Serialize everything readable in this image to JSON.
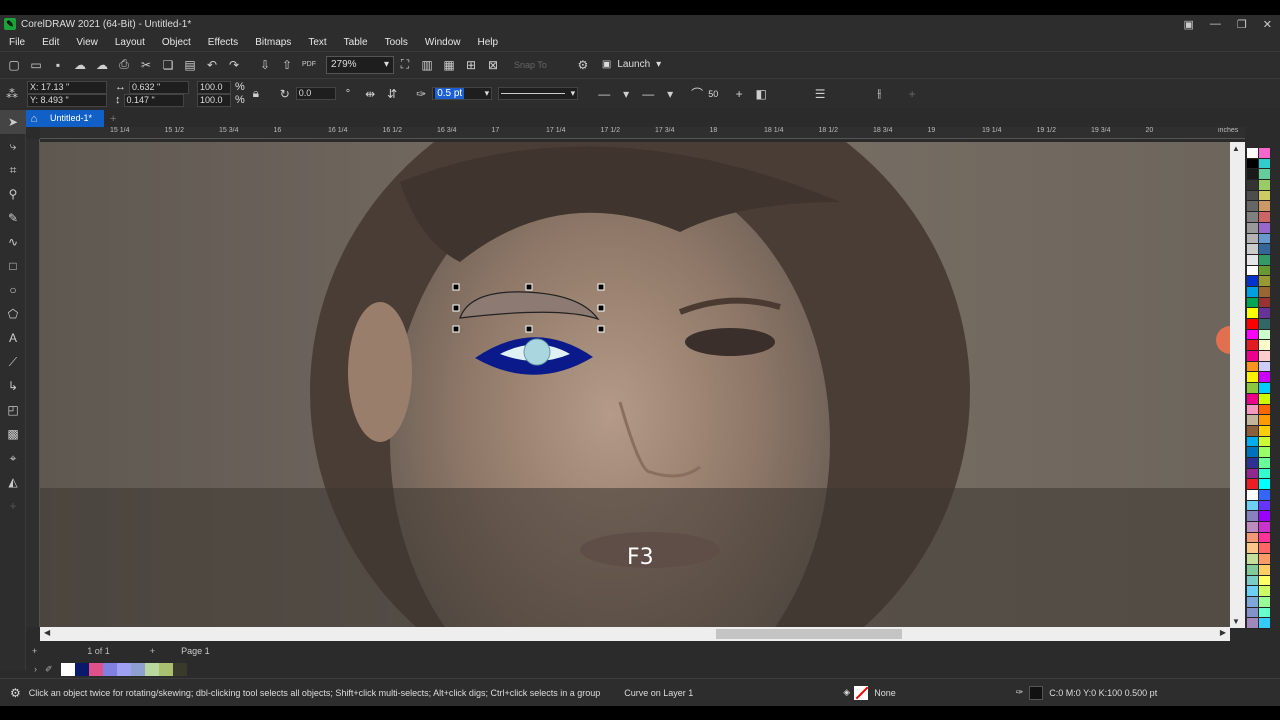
{
  "window": {
    "title": "CorelDRAW 2021 (64-Bit) - Untitled-1*"
  },
  "menu": [
    "File",
    "Edit",
    "View",
    "Layout",
    "Object",
    "Effects",
    "Bitmaps",
    "Text",
    "Table",
    "Tools",
    "Window",
    "Help"
  ],
  "toolbar": {
    "zoom": "279%",
    "pdf_label": "PDF",
    "snap_to": "Snap To",
    "launch_label": "Launch"
  },
  "property_bar": {
    "x": "X: 17.13 \"",
    "y": "Y: 8.493 \"",
    "w": "0.632 \"",
    "h": "0.147 \"",
    "scale_w": "100.0",
    "scale_h": "100.0",
    "percent": "%",
    "rotation": "0.0",
    "outline_width": "0.5 pt",
    "smoothing": "50"
  },
  "document": {
    "tab": "Untitled-1*",
    "page_count": "1 of 1",
    "page_tab": "Page 1"
  },
  "ruler": {
    "ticks": [
      "15 1/4",
      "15 1/2",
      "15 3/4",
      "16",
      "16 1/4",
      "16 1/2",
      "16 3/4",
      "17",
      "17 1/4",
      "17 1/2",
      "17 3/4",
      "18",
      "18 1/4",
      "18 1/2",
      "18 3/4",
      "19",
      "19 1/4",
      "19 1/2",
      "19 3/4",
      "20"
    ],
    "unit": "inches"
  },
  "canvas": {
    "overlay_text": "F3"
  },
  "status": {
    "hint": "Click an object twice for rotating/skewing; dbl-clicking tool selects all objects; Shift+click multi-selects; Alt+click digs; Ctrl+click selects in a group",
    "object_info": "Curve on Layer 1",
    "fill": "None",
    "outline_info": "C:0 M:0 Y:0 K:100  0.500 pt"
  },
  "colors": {
    "accent": "#1060c8",
    "eye_outline": "#0a1a8a",
    "iris": "#a9d6df"
  },
  "palette_col1": [
    "#ffffff",
    "#000000",
    "#1a1a1a",
    "#333333",
    "#4d4d4d",
    "#666666",
    "#808080",
    "#999999",
    "#b3b3b3",
    "#cccccc",
    "#e6e6e6",
    "#ffffff",
    "#0033cc",
    "#00a0e0",
    "#00a651",
    "#ffff00",
    "#ff0000",
    "#ff00ff",
    "#e31b23",
    "#ec008c",
    "#f7941d",
    "#fff200",
    "#8dc63f",
    "#ec008c",
    "#f49ac1",
    "#c2b59b",
    "#8b5e3c",
    "#00aeef",
    "#0072bc",
    "#2e3192",
    "#92278f",
    "#ed1c24",
    "#ffffff",
    "#6dcff6",
    "#8781bd",
    "#bd8cbf",
    "#f69679",
    "#fdc689",
    "#c4df9b",
    "#82ca9c",
    "#7accc8",
    "#6dcff6",
    "#7da7d9",
    "#8393ca",
    "#a187be"
  ],
  "palette_col2": [
    "#ff66cc",
    "#33cccc",
    "#66cc99",
    "#99cc66",
    "#cccc66",
    "#cc9966",
    "#cc6666",
    "#9966cc",
    "#6699cc",
    "#336699",
    "#339966",
    "#669933",
    "#999933",
    "#996633",
    "#993333",
    "#663399",
    "#336666",
    "#ccffcc",
    "#ffffcc",
    "#ffcccc",
    "#ccccff",
    "#cc00ff",
    "#00ccff",
    "#ccff00",
    "#ff6600",
    "#ff9900",
    "#ffcc00",
    "#ccff33",
    "#99ff66",
    "#66ff99",
    "#33ffcc",
    "#00ffff",
    "#3366ff",
    "#6633ff",
    "#9900ff",
    "#cc33cc",
    "#ff3399",
    "#ff6666",
    "#ff9966",
    "#ffcc66",
    "#ffff66",
    "#ccff66",
    "#99ff99",
    "#66ffcc",
    "#33ccff"
  ],
  "doc_palette": [
    "#ffffff",
    "#0a1a6a",
    "#e0508a",
    "#8080e0",
    "#a0a0f0",
    "#8fa0d0",
    "#b8d8a0",
    "#a8c070",
    "#3a3a2a"
  ]
}
